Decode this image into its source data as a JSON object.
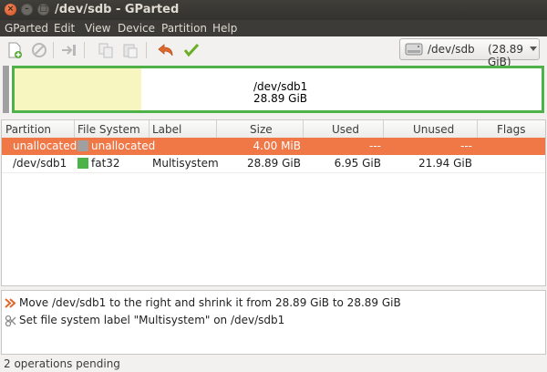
{
  "window": {
    "title": "/dev/sdb - GParted",
    "close_glyph": "×",
    "min_glyph": "–",
    "max_glyph": "□"
  },
  "menu": [
    "GParted",
    "Edit",
    "View",
    "Device",
    "Partition",
    "Help"
  ],
  "toolbar_icons": [
    "new-partition-icon",
    "delete-icon",
    "resize-move-icon",
    "copy-icon",
    "paste-icon",
    "undo-icon",
    "apply-icon"
  ],
  "device": {
    "name": "/dev/sdb",
    "size": "(28.89 GiB)"
  },
  "visual": {
    "partition_name": "/dev/sdb1",
    "partition_size": "28.89 GiB",
    "used_fraction": 0.24,
    "fs_color": "#4db348",
    "used_color": "#f8f6c0",
    "unallocated_color": "#a0a0a0"
  },
  "table": {
    "columns": [
      "Partition",
      "File System",
      "Label",
      "Size",
      "Used",
      "Unused",
      "Flags"
    ],
    "rows": [
      {
        "partition": "unallocated",
        "fs": "unallocated",
        "fs_color": "#a0a0a0",
        "label": "",
        "size": "4.00 MiB",
        "used": "---",
        "unused": "---",
        "flags": "",
        "selected": true
      },
      {
        "partition": "/dev/sdb1",
        "fs": "fat32",
        "fs_color": "#4db348",
        "label": "Multisystem",
        "size": "28.89 GiB",
        "used": "6.95 GiB",
        "unused": "21.94 GiB",
        "flags": "",
        "selected": false
      }
    ]
  },
  "operations": [
    {
      "icon": "move-resize-icon",
      "text": "Move /dev/sdb1 to the right and shrink it from 28.89 GiB to 28.89 GiB"
    },
    {
      "icon": "label-icon",
      "text": "Set file system label \"Multisystem\" on /dev/sdb1"
    }
  ],
  "status": "2 operations pending",
  "colors": {
    "selection": "#f07746",
    "titlebar": "#3c3b37"
  }
}
